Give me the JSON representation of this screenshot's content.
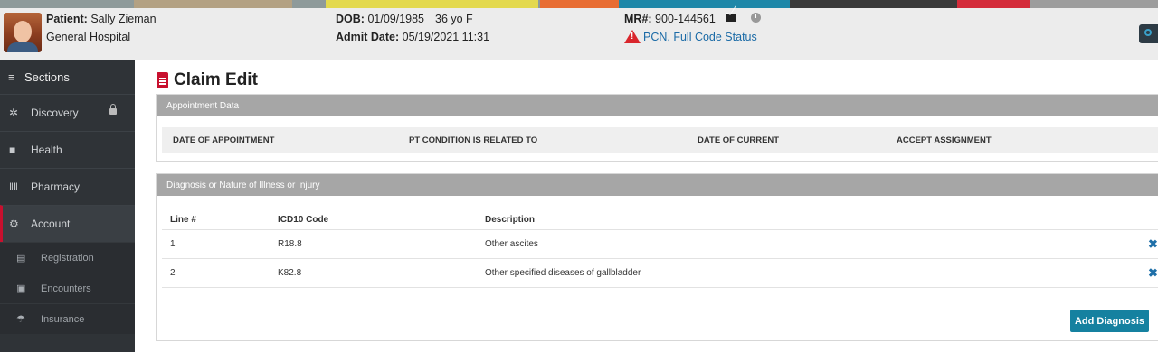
{
  "header": {
    "patient_label": "Patient:",
    "patient_name": "Sally Zieman",
    "facility": "General Hospital",
    "dob_label": "DOB:",
    "dob": "01/09/1985",
    "age_sex": "36 yo F",
    "admit_label": "Admit Date:",
    "admit_date": "05/19/2021 11:31",
    "mr_label": "MR#:",
    "mr_number": "900-144561",
    "alert_text": "PCN, Full Code Status",
    "alert_icon": "warning-triangle-icon",
    "color_bar": [
      "#8e9a9a",
      "#b3a183",
      "#8e9a9a",
      "#e3d94e",
      "#8e9a9a",
      "#e86d33",
      "#8e9a9a",
      "#1e87a8",
      "#3a3a3a",
      "#d42b3a",
      "#9d9d9d"
    ]
  },
  "sidebar": {
    "title": "Sections",
    "items": [
      {
        "label": "Discovery",
        "icon": "gear-icon",
        "locked": true
      },
      {
        "label": "Health",
        "icon": "medkit-icon"
      },
      {
        "label": "Pharmacy",
        "icon": "barcode-icon"
      },
      {
        "label": "Account",
        "icon": "cogs-icon",
        "active": true
      }
    ],
    "sub_items": [
      {
        "label": "Registration",
        "icon": "clipboard-icon"
      },
      {
        "label": "Encounters",
        "icon": "id-card-icon"
      },
      {
        "label": "Insurance",
        "icon": "umbrella-icon"
      }
    ]
  },
  "main": {
    "title": "Claim Edit",
    "appointment_panel": {
      "title": "Appointment Data",
      "columns": [
        "DATE OF APPOINTMENT",
        "PT CONDITION IS RELATED TO",
        "DATE OF CURRENT",
        "ACCEPT ASSIGNMENT"
      ]
    },
    "diagnosis_panel": {
      "title": "Diagnosis or Nature of Illness or Injury",
      "columns": [
        "Line #",
        "ICD10 Code",
        "Description"
      ],
      "rows": [
        {
          "line": "1",
          "code": "R18.8",
          "description": "Other ascites"
        },
        {
          "line": "2",
          "code": "K82.8",
          "description": "Other specified diseases of gallbladder"
        }
      ],
      "add_button": "Add Diagnosis"
    }
  }
}
